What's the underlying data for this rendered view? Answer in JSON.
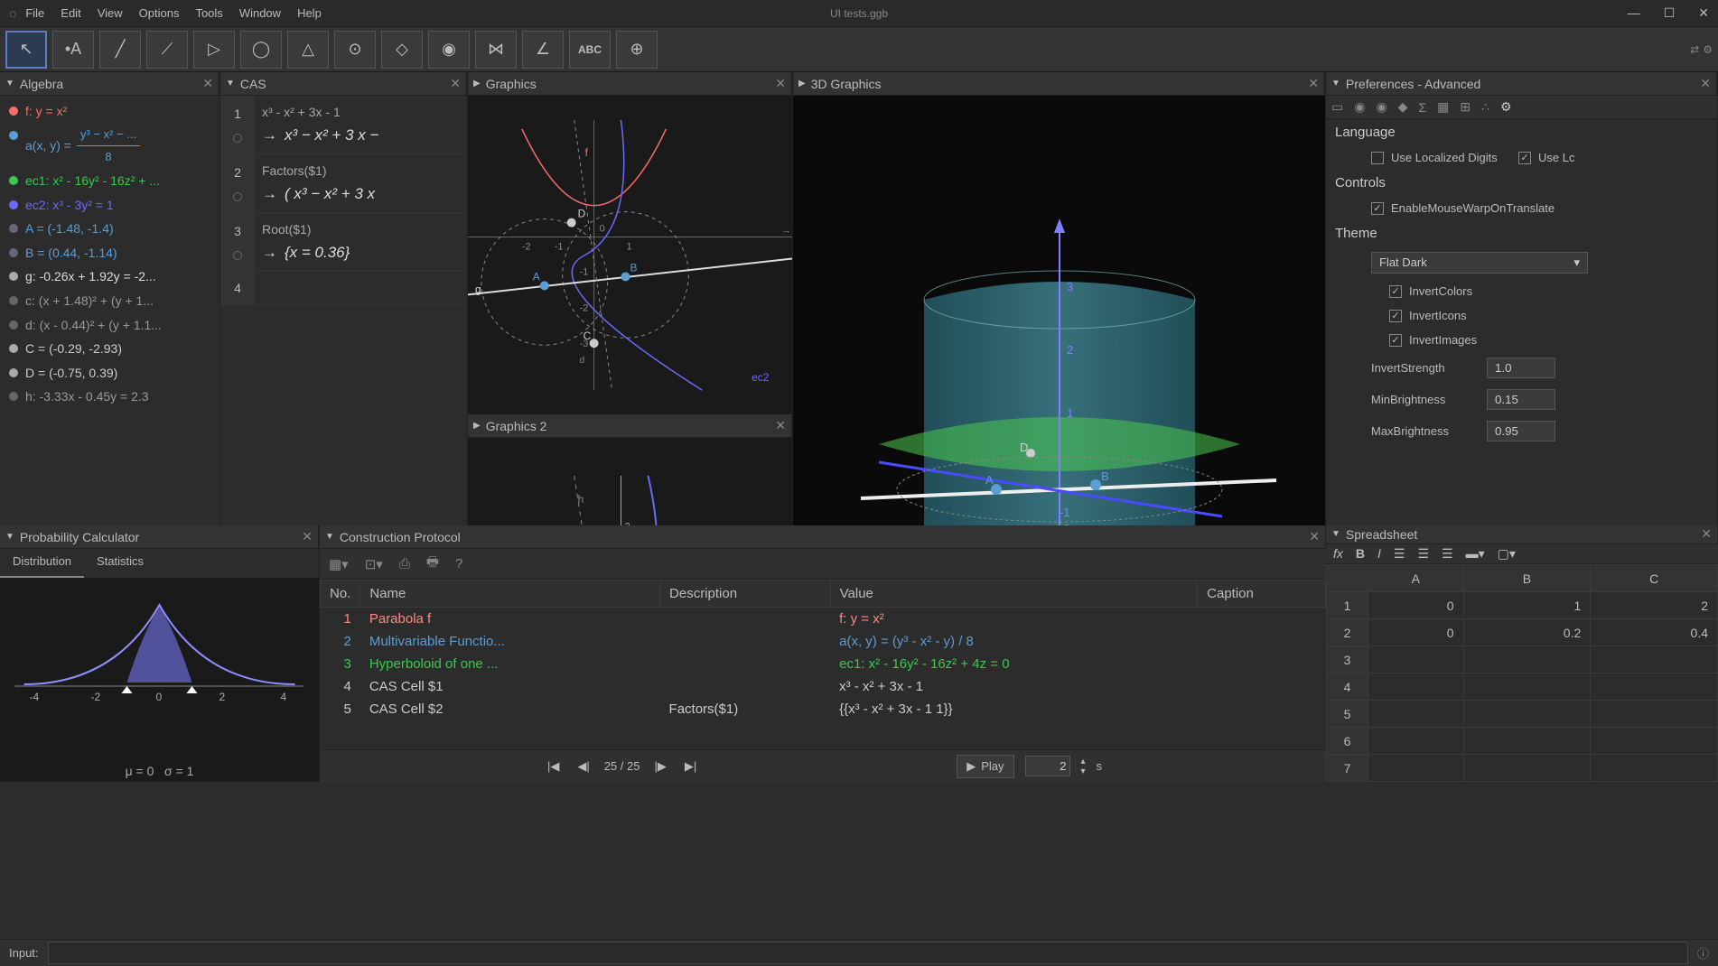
{
  "title": "UI tests.ggb",
  "menu": [
    "File",
    "Edit",
    "View",
    "Options",
    "Tools",
    "Window",
    "Help"
  ],
  "panels": {
    "algebra": "Algebra",
    "cas": "CAS",
    "graphics": "Graphics",
    "graphics2": "Graphics 2",
    "gfx3d": "3D Graphics",
    "prefs": "Preferences - Advanced",
    "spreadsheet": "Spreadsheet",
    "probcalc": "Probability Calculator",
    "constr": "Construction Protocol"
  },
  "algebra": [
    {
      "text": "f: y = x²",
      "color": "#ff6b6b",
      "bullet": "#ff6b6b"
    },
    {
      "text": "a(x, y) = ",
      "color": "#5c9dd4",
      "frac": true,
      "num": "y³ − x² − ...",
      "den": "8",
      "bullet": "#5c9dd4"
    },
    {
      "text": "ec1: x² - 16y² - 16z² + ...",
      "color": "#3cc84e",
      "bullet": "#3cc84e"
    },
    {
      "text": "ec2: x³ - 3y² = 1",
      "color": "#6a6aff",
      "bullet": "#6a6aff"
    },
    {
      "text": "A = (-1.48, -1.4)",
      "color": "#5c9dd4",
      "bullet": "#667"
    },
    {
      "text": "B = (0.44, -1.14)",
      "color": "#5c9dd4",
      "bullet": "#667"
    },
    {
      "text": "g: -0.26x + 1.92y = -2...",
      "color": "#ddd",
      "bullet": "#aaa"
    },
    {
      "text": "c: (x + 1.48)² + (y + 1...",
      "color": "#999",
      "bullet": "#666"
    },
    {
      "text": "d: (x - 0.44)² + (y + 1.1...",
      "color": "#999",
      "bullet": "#666"
    },
    {
      "text": "C = (-0.29, -2.93)",
      "color": "#ccc",
      "bullet": "#aaa"
    },
    {
      "text": "D = (-0.75, 0.39)",
      "color": "#ccc",
      "bullet": "#aaa"
    },
    {
      "text": "h: -3.33x - 0.45y = 2.3",
      "color": "#999",
      "bullet": "#666"
    }
  ],
  "cas": [
    {
      "n": "1",
      "in": "x³ - x² + 3x - 1",
      "out": "x³ − x² + 3 x −"
    },
    {
      "n": "2",
      "in": "Factors($1)",
      "out": "( x³ − x² + 3 x"
    },
    {
      "n": "3",
      "in": "Root($1)",
      "out": "{x = 0.36}"
    },
    {
      "n": "4",
      "in": "",
      "out": ""
    }
  ],
  "prefs": {
    "sections": {
      "lang": "Language",
      "controls": "Controls",
      "theme": "Theme"
    },
    "localized": "Use Localized Digits",
    "uselc": "Use Lc",
    "mousewarp": "EnableMouseWarpOnTranslate",
    "themesel": "Flat Dark",
    "invcolors": "InvertColors",
    "invicons": "InvertIcons",
    "invimages": "InvertImages",
    "invstr": "InvertStrength",
    "invstr_v": "1.0",
    "minbr": "MinBrightness",
    "minbr_v": "0.15",
    "maxbr": "MaxBrightness",
    "maxbr_v": "0.95"
  },
  "spreadsheet": {
    "cols": [
      "A",
      "B",
      "C"
    ],
    "rows": [
      [
        "1",
        "0",
        "1",
        "2"
      ],
      [
        "2",
        "0",
        "0.2",
        "0.4"
      ],
      [
        "3",
        "",
        "",
        ""
      ],
      [
        "4",
        "",
        "",
        ""
      ],
      [
        "5",
        "",
        "",
        ""
      ],
      [
        "6",
        "",
        "",
        ""
      ],
      [
        "7",
        "",
        "",
        ""
      ]
    ]
  },
  "probcalc": {
    "tabs": [
      "Distribution",
      "Statistics"
    ],
    "mu": "μ = 0",
    "sigma": "σ = 1",
    "ticks": [
      "-4",
      "-2",
      "0",
      "2",
      "4"
    ]
  },
  "constr": {
    "cols": [
      "No.",
      "Name",
      "Description",
      "Value",
      "Caption"
    ],
    "rows": [
      {
        "no": "1",
        "name": "Parabola f",
        "desc": "",
        "val": "f: y = x²",
        "color": "#ff8888"
      },
      {
        "no": "2",
        "name": "Multivariable Functio...",
        "desc": "",
        "val": "a(x, y) = (y³ - x² - y) / 8",
        "color": "#5c9dd4"
      },
      {
        "no": "3",
        "name": "Hyperboloid of one ...",
        "desc": "",
        "val": "ec1: x² - 16y² - 16z² + 4z = 0",
        "color": "#3cc84e"
      },
      {
        "no": "4",
        "name": "CAS Cell $1",
        "desc": "",
        "val": "x³ - x² + 3x - 1",
        "color": "#ccc"
      },
      {
        "no": "5",
        "name": "CAS Cell $2",
        "desc": "Factors($1)",
        "val": "{{x³ - x² + 3x - 1  1}}",
        "color": "#ccc"
      }
    ],
    "page": "25 / 25",
    "play": "Play",
    "secval": "2",
    "secunit": "s"
  },
  "inputlabel": "Input:",
  "chart_data": {
    "type": "line",
    "title": "Standard Normal Distribution",
    "mu": 0,
    "sigma": 1,
    "xlim": [
      -4.5,
      4.5
    ],
    "xticks": [
      -4,
      -2,
      0,
      2,
      4
    ],
    "ylim": [
      0,
      0.42
    ],
    "fill_interval": [
      -1,
      1
    ]
  }
}
